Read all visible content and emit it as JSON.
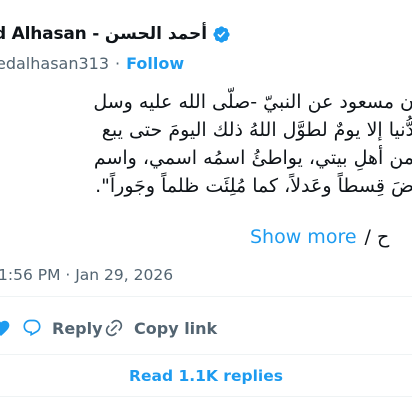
{
  "author": {
    "name": "d Alhasan - أحمد الحسن",
    "handle": "edalhasan313",
    "follow_label": "Follow"
  },
  "tweet": {
    "lines": [
      "ن مسعود عن النبيّ -صلّى الله عليه وسل",
      "دُّنيا إلا يومٌ لطوَّل اللهُ ذلك اليومَ حتى يبع",
      "من أهلِ بيتي، يواطئُ اسمُه اسمي، واسم",
      "ضَ قِسطاً وعَدلاً، كما مُلِئَت ظلماً وجَوراً\"."
    ],
    "show_more_label": "Show more",
    "separator": "/",
    "tail_text": "ح"
  },
  "meta": {
    "time": "1:56 PM · Jan 29, 2026"
  },
  "actions": {
    "reply_label": "Reply",
    "copy_link_label": "Copy link"
  },
  "read_replies_label": "Read 1.1K replies",
  "colors": {
    "accent": "#1d9bf0",
    "text": "#0f1419",
    "muted": "#536471",
    "divider": "#eff3f4",
    "heart": "#f91880"
  },
  "icons": [
    "verified-badge-icon",
    "heart-icon",
    "reply-icon",
    "link-icon"
  ]
}
